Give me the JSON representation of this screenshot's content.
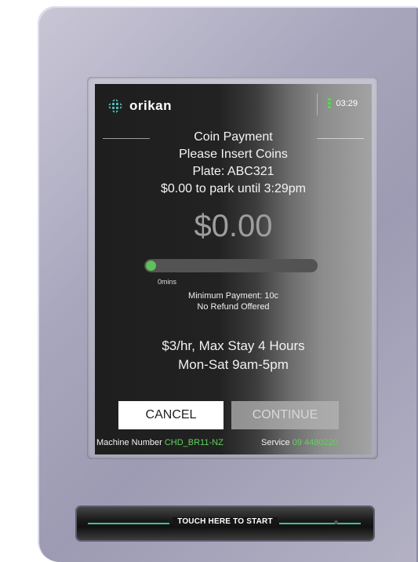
{
  "header": {
    "brand": "orikan",
    "time": "03:29"
  },
  "payment": {
    "title": "Coin Payment",
    "instruction": "Please Insert Coins",
    "plate": "Plate: ABC321",
    "summary": "$0.00 to park until 3:29pm",
    "amount": "$0.00",
    "progress_percent": 0,
    "progress_label": "0mins",
    "minimum": "Minimum Payment: 10c",
    "refund": "No Refund Offered",
    "rate": "$3/hr, Max Stay 4 Hours",
    "hours": "Mon-Sat 9am-5pm"
  },
  "buttons": {
    "cancel": "CANCEL",
    "continue": "CONTINUE"
  },
  "footer": {
    "machine_label": "Machine Number",
    "machine_number": "CHD_BR11-NZ",
    "service_label": "Service",
    "service_number": "09 4480220"
  },
  "touch": {
    "label": "TOUCH HERE TO START"
  },
  "colors": {
    "accent": "#5cc25a",
    "brand": "#4fc6c2"
  },
  "icons": {
    "logo": "orikan-logo-icon",
    "battery": "battery-icon"
  }
}
